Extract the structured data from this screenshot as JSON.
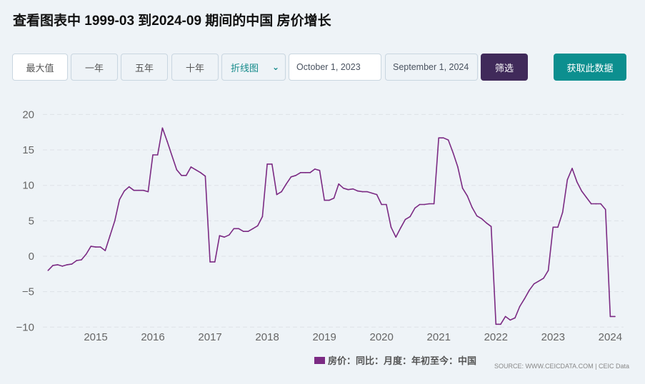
{
  "title": "查看图表中 1999-03 到2024-09 期间的中国 房价增长",
  "toolbar": {
    "max": "最大值",
    "one_year": "一年",
    "five_year": "五年",
    "ten_year": "十年",
    "chart_type": "折线图",
    "start_date": "October 1, 2023",
    "end_date": "September 1, 2024",
    "filter": "筛选",
    "fetch": "获取此数据"
  },
  "source": "SOURCE: WWW.CEICDATA.COM | CEIC Data",
  "chart_data": {
    "type": "line",
    "title": "",
    "xlabel": "",
    "ylabel": "",
    "ylim": [
      -10,
      20
    ],
    "yticks": [
      "20",
      "15",
      "10",
      "5",
      "0",
      "−5",
      "−10"
    ],
    "ytick_values": [
      20,
      15,
      10,
      5,
      0,
      -5,
      -10
    ],
    "xticks": [
      "2015",
      "2016",
      "2017",
      "2018",
      "2019",
      "2020",
      "2021",
      "2022",
      "2023",
      "2024"
    ],
    "start_month": "2014-03",
    "frequency": "monthly",
    "grid": true,
    "color": "#7b2a83",
    "legend": "bottom",
    "series": [
      {
        "name": "房价：同比：月度：年初至今：中国",
        "values": [
          -2.0,
          -1.3,
          -1.2,
          -1.4,
          -1.2,
          -1.1,
          -0.6,
          -0.5,
          0.3,
          1.4,
          1.3,
          1.3,
          0.8,
          2.9,
          5.0,
          8.0,
          9.2,
          9.8,
          9.3,
          9.3,
          9.3,
          9.1,
          14.3,
          14.3,
          18.1,
          16.2,
          14.2,
          12.2,
          11.4,
          11.4,
          12.6,
          12.2,
          11.8,
          11.3,
          -0.8,
          -0.8,
          2.9,
          2.7,
          3.0,
          3.9,
          3.9,
          3.5,
          3.5,
          3.9,
          4.3,
          5.6,
          13.0,
          13.0,
          8.7,
          9.1,
          10.2,
          11.2,
          11.4,
          11.8,
          11.8,
          11.8,
          12.3,
          12.1,
          7.9,
          7.9,
          8.2,
          10.2,
          9.6,
          9.4,
          9.5,
          9.2,
          9.1,
          9.1,
          8.9,
          8.7,
          7.3,
          7.3,
          4.1,
          2.7,
          4.0,
          5.2,
          5.6,
          6.8,
          7.3,
          7.3,
          7.4,
          7.4,
          16.7,
          16.7,
          16.4,
          14.6,
          12.6,
          9.6,
          8.5,
          6.9,
          5.7,
          5.3,
          4.7,
          4.2,
          -9.6,
          -9.6,
          -8.5,
          -9.0,
          -8.7,
          -7.1,
          -6.0,
          -4.8,
          -3.9,
          -3.5,
          -3.1,
          -2.0,
          4.1,
          4.1,
          6.2,
          10.8,
          12.4,
          10.5,
          9.2,
          8.3,
          7.4,
          7.4,
          7.4,
          6.6,
          -8.5,
          -8.5
        ]
      }
    ]
  }
}
